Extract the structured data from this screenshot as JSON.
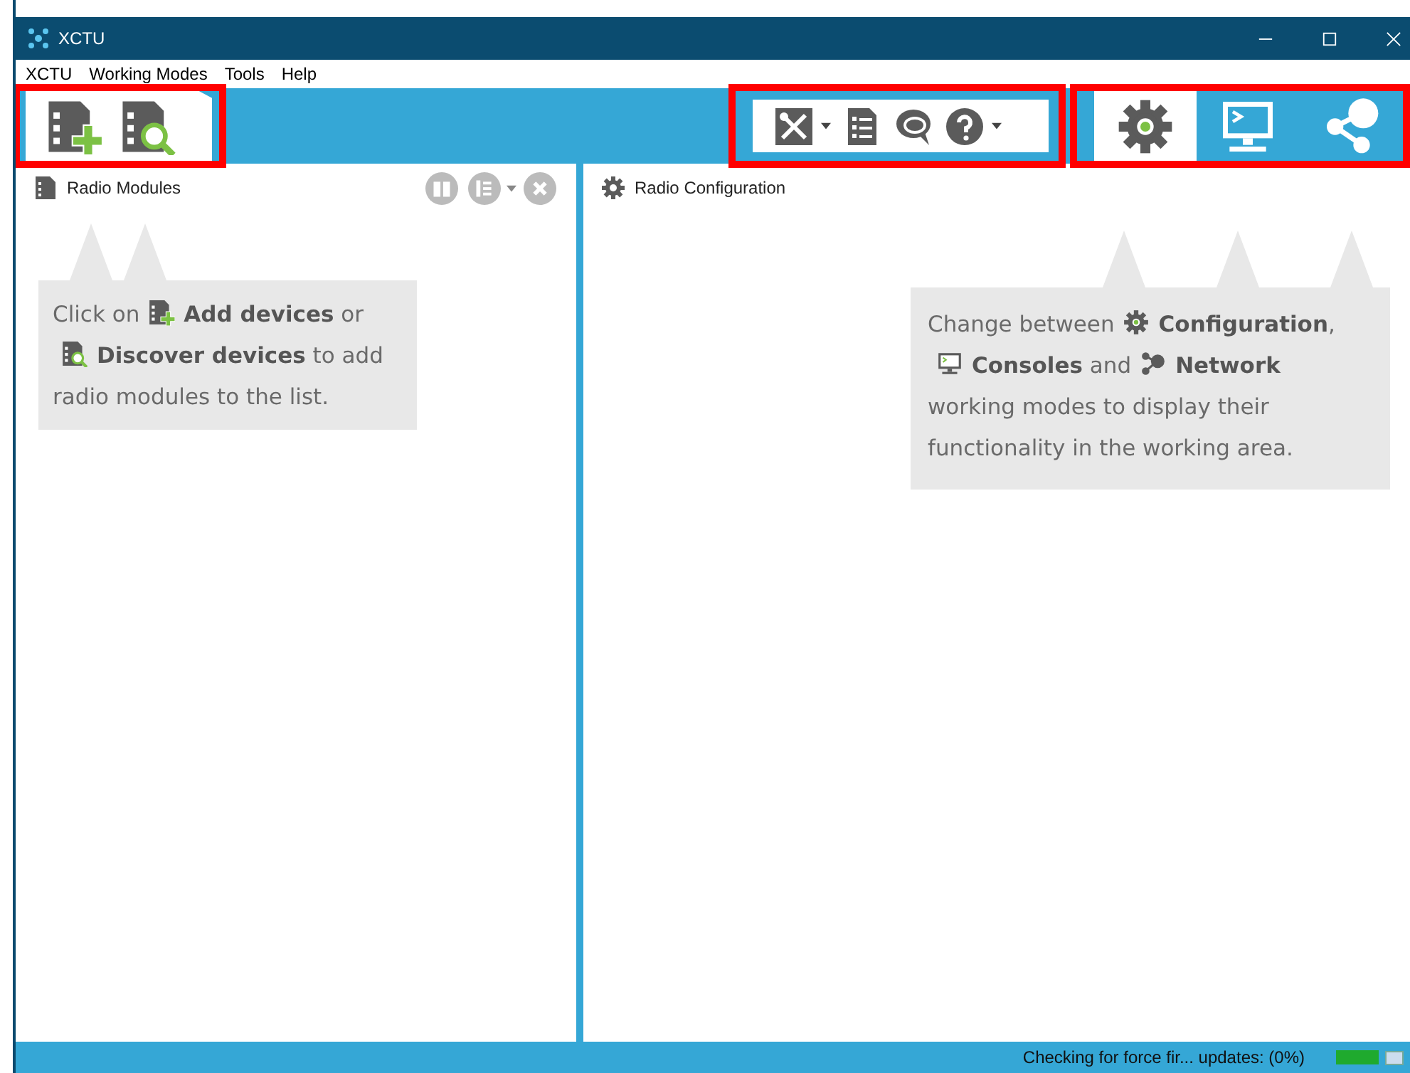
{
  "window": {
    "title": "XCTU"
  },
  "menu": [
    "XCTU",
    "Working Modes",
    "Tools",
    "Help"
  ],
  "toolbar": {
    "device_buttons": [
      {
        "kind": "add"
      },
      {
        "kind": "discover"
      }
    ],
    "tool_buttons": [
      {
        "kind": "tools",
        "dropdown": true
      },
      {
        "kind": "log",
        "dropdown": false
      },
      {
        "kind": "chat",
        "dropdown": false
      },
      {
        "kind": "help",
        "dropdown": true
      }
    ],
    "mode_tabs": [
      {
        "kind": "config",
        "selected": true
      },
      {
        "kind": "console",
        "selected": false
      },
      {
        "kind": "network",
        "selected": false
      }
    ]
  },
  "left_panel": {
    "title": "Radio Modules",
    "tip": [
      [
        {
          "kind": "text",
          "text": "Click on"
        },
        {
          "kind": "add"
        },
        {
          "kind": "text",
          "text": "**Add devices** or"
        }
      ],
      [
        {
          "kind": "discover"
        },
        {
          "kind": "text",
          "text": "**Discover devices** to add"
        }
      ],
      [
        {
          "kind": "text",
          "text": "radio modules to the list."
        }
      ]
    ]
  },
  "right_panel": {
    "title": "Radio Configuration",
    "tip": [
      [
        {
          "kind": "text",
          "text": "Change between"
        },
        {
          "kind": "config"
        },
        {
          "kind": "text",
          "text": "**Configuration**,"
        }
      ],
      [
        {
          "kind": "console"
        },
        {
          "kind": "text",
          "text": "**Consoles** and"
        },
        {
          "kind": "network"
        },
        {
          "kind": "text",
          "text": "**Network**"
        }
      ],
      [
        {
          "kind": "text",
          "text": "working modes to display their"
        }
      ],
      [
        {
          "kind": "text",
          "text": "functionality in the working area."
        }
      ]
    ]
  },
  "status_bar": {
    "text": "Checking for force fir... updates: (0%)",
    "level": 1
  }
}
